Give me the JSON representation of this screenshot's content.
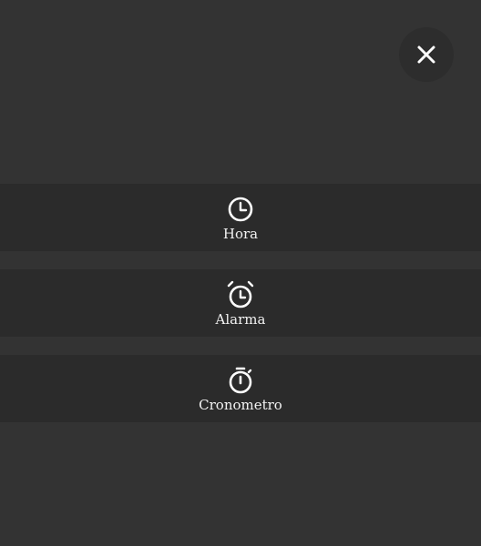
{
  "close": {
    "icon": "close-icon"
  },
  "menu": {
    "items": [
      {
        "label": "Hora",
        "icon": "clock-icon"
      },
      {
        "label": "Alarma",
        "icon": "alarm-clock-icon"
      },
      {
        "label": "Cronometro",
        "icon": "stopwatch-icon"
      }
    ]
  },
  "colors": {
    "background": "#333333",
    "item_background": "#2b2b2b",
    "close_background": "#2d2d2d",
    "foreground": "#ffffff"
  }
}
